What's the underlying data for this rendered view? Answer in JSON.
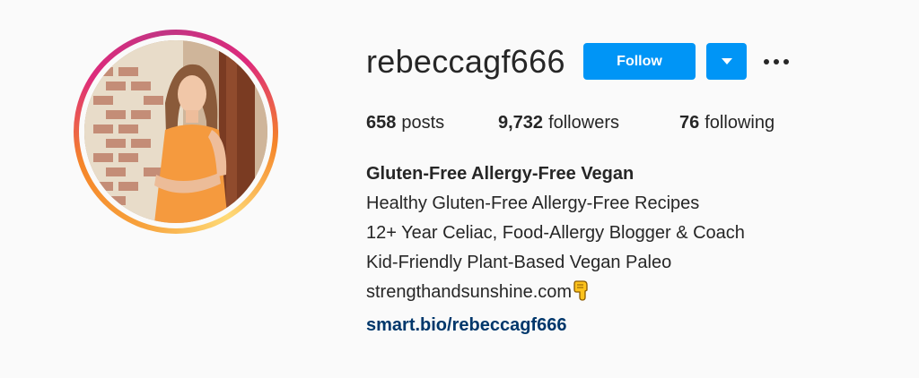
{
  "profile": {
    "username": "rebeccagf666",
    "follow_label": "Follow",
    "stats": {
      "posts_count": "658",
      "posts_label": "posts",
      "followers_count": "9,732",
      "followers_label": "followers",
      "following_count": "76",
      "following_label": "following"
    },
    "bio": {
      "full_name": "Gluten-Free Allergy-Free Vegan",
      "lines": [
        "Healthy Gluten-Free Allergy-Free Recipes",
        "12+ Year Celiac, Food-Allergy Blogger & Coach",
        "Kid-Friendly Plant-Based Vegan Paleo",
        "strengthandsunshine.com"
      ],
      "emoji": "pointing-down-hand-emoji",
      "link": "smart.bio/rebeccagf666"
    }
  },
  "colors": {
    "primary_button": "#0095f6",
    "link": "#00376b",
    "text": "#262626",
    "background": "#fafafa"
  },
  "icons": {
    "dropdown": "chevron-down-icon",
    "more": "more-options-icon"
  }
}
